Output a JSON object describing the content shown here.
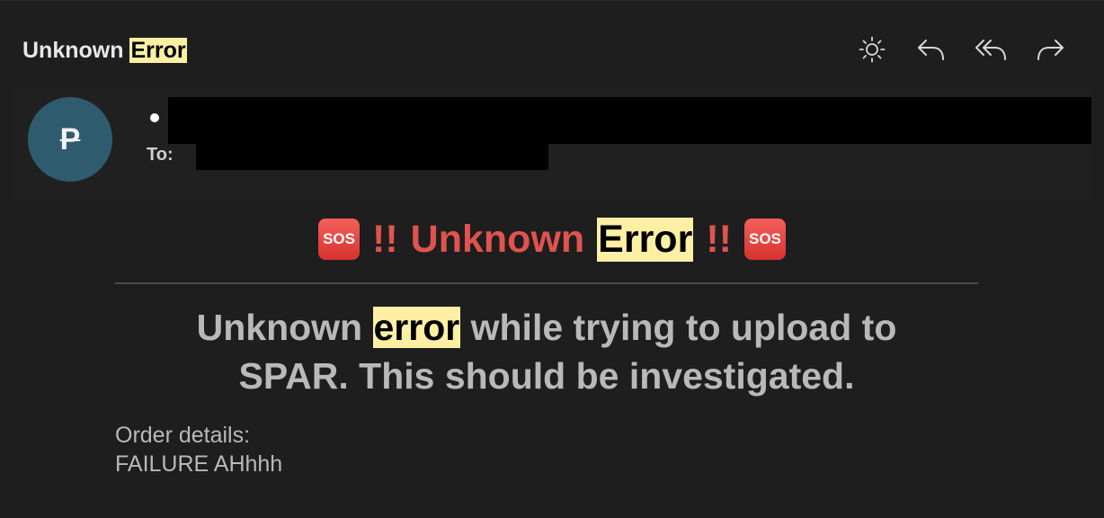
{
  "header": {
    "subject_prefix": "Unknown",
    "subject_highlight": "Error"
  },
  "toolbar": {
    "icons": [
      "sun-icon",
      "reply-icon",
      "reply-all-icon",
      "forward-icon"
    ]
  },
  "sender": {
    "avatar_letter": "P",
    "to_label": "To:"
  },
  "body": {
    "heading_badge": "SOS",
    "heading_bang": "!!",
    "heading_prefix": "Unknown",
    "heading_highlight": "Error",
    "message_prefix": "Unknown",
    "message_highlight": "error",
    "message_line1_rest": "while trying to upload to",
    "message_line2": "SPAR. This should be investigated.",
    "details_label": "Order details:",
    "details_value": "FAILURE AHhhh"
  },
  "colors": {
    "background": "#1e1e1e",
    "highlight": "#fdf0a4",
    "alert_red": "#e0534f",
    "avatar": "#2f5b6f",
    "redaction": "#000000"
  }
}
